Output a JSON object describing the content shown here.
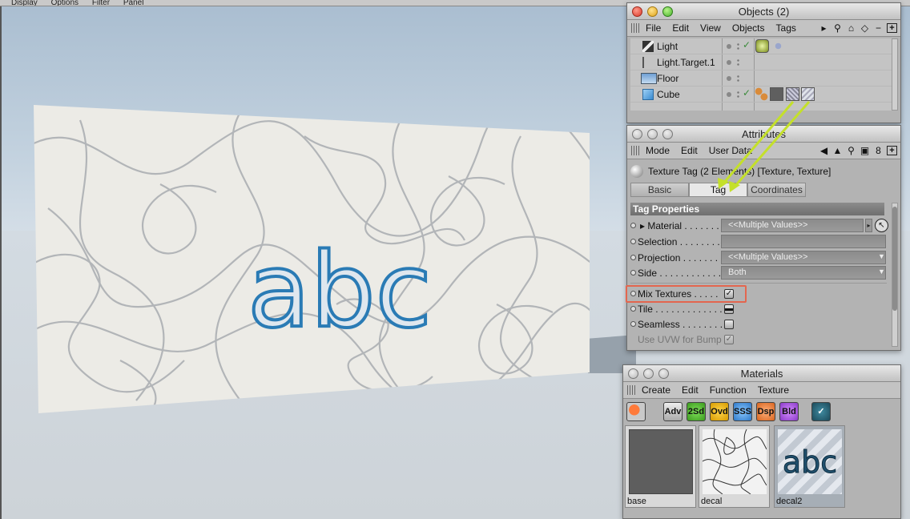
{
  "menubar": {
    "items": [
      "Display",
      "Options",
      "Filter",
      "Panel"
    ]
  },
  "viewport": {
    "decal_text": "abc",
    "colors": {
      "decal": "#2a7bb5",
      "wall": "#ecebe6",
      "sky": "#b4c6d6",
      "floor": "#d3dae0"
    }
  },
  "objects_window": {
    "title": "Objects (2)",
    "menu": [
      "File",
      "Edit",
      "View",
      "Objects",
      "Tags"
    ],
    "rows": [
      {
        "name": "Light",
        "icon": "light-icon"
      },
      {
        "name": "Light.Target.1",
        "icon": "target-icon"
      },
      {
        "name": "Floor",
        "icon": "floor-icon"
      },
      {
        "name": "Cube",
        "icon": "cube-icon"
      }
    ]
  },
  "attributes_window": {
    "title": "Attributes",
    "menu": [
      "Mode",
      "Edit",
      "User Data"
    ],
    "subtitle": "Texture Tag (2 Elements) [Texture, Texture]",
    "tabs": [
      "Basic",
      "Tag",
      "Coordinates"
    ],
    "active_tab": "Tag",
    "section": "Tag Properties",
    "props": {
      "material": {
        "label": "Material",
        "dots": " . . . . . . .",
        "value": "<<Multiple Values>>"
      },
      "selection": {
        "label": "Selection",
        "dots": " . . . . . . . ."
      },
      "projection": {
        "label": "Projection",
        "dots": " . . . . . . .",
        "value": "<<Multiple Values>>"
      },
      "side": {
        "label": "Side",
        "dots": " . . . . . . . . . . . .",
        "value": "Both"
      },
      "mix": {
        "label": "Mix Textures",
        "dots": " . . . . .",
        "checked": true
      },
      "tile": {
        "label": "Tile",
        "dots": " . . . . . . . . . . . . ."
      },
      "seamless": {
        "label": "Seamless",
        "dots": " . . . . . . . ."
      },
      "uvw": {
        "label": "Use UVW for Bump",
        "checked": true
      }
    }
  },
  "materials_window": {
    "title": "Materials",
    "menu": [
      "Create",
      "Edit",
      "Function",
      "Texture"
    ],
    "tools": [
      "Adv",
      "2Sd",
      "Ovd",
      "SSS",
      "Dsp",
      "Bld"
    ],
    "items": [
      {
        "name": "base"
      },
      {
        "name": "decal"
      },
      {
        "name": "decal2",
        "preview_text": "abc"
      }
    ]
  }
}
